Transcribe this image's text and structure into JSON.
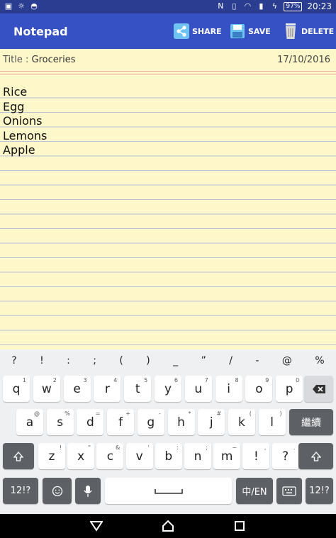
{
  "status_bar": {
    "time": "20:23",
    "battery": "97%"
  },
  "app": {
    "title": "Notepad"
  },
  "actions": {
    "share": "SHARE",
    "save": "SAVE",
    "delete": "DELETE"
  },
  "note": {
    "title_prefix": "Title : ",
    "title": "Groceries",
    "date": "17/10/2016",
    "lines": [
      "Rice",
      "Egg",
      "Onions",
      "Lemons",
      "Apple"
    ]
  },
  "keyboard": {
    "suggestions": [
      "?",
      "!",
      ":",
      ";",
      "(",
      ")",
      "_",
      "”",
      "/",
      "-",
      "@",
      "%"
    ],
    "row1": [
      {
        "k": "q",
        "s": "1"
      },
      {
        "k": "w",
        "s": "2"
      },
      {
        "k": "e",
        "s": "3"
      },
      {
        "k": "r",
        "s": "4"
      },
      {
        "k": "t",
        "s": "5"
      },
      {
        "k": "y",
        "s": "6"
      },
      {
        "k": "u",
        "s": "7"
      },
      {
        "k": "i",
        "s": "8"
      },
      {
        "k": "o",
        "s": "9"
      },
      {
        "k": "p",
        "s": "0"
      }
    ],
    "row2": [
      {
        "k": "a",
        "s": "@"
      },
      {
        "k": "s",
        "s": "%"
      },
      {
        "k": "d",
        "s": "="
      },
      {
        "k": "f",
        "s": "+"
      },
      {
        "k": "g",
        "s": "-"
      },
      {
        "k": "h",
        "s": "*"
      },
      {
        "k": "j",
        "s": "#"
      },
      {
        "k": "k",
        "s": "("
      },
      {
        "k": "l",
        "s": ")"
      }
    ],
    "row3": [
      {
        "k": "z",
        "s": "!"
      },
      {
        "k": "x",
        "s": "“"
      },
      {
        "k": "c",
        "s": "&"
      },
      {
        "k": "v",
        "s": "'"
      },
      {
        "k": "b",
        "s": ":"
      },
      {
        "k": "n",
        "s": ";"
      },
      {
        "k": "m",
        "s": "~"
      },
      {
        "k": "!",
        "s": ","
      },
      {
        "k": "?",
        "s": "."
      }
    ],
    "enter_label": "繼續",
    "sym_label": "12!?",
    "lang_label": "中/EN"
  },
  "colors": {
    "status_bar": "#2b3d91",
    "app_bar": "#3551c4",
    "paper": "#fef7c9",
    "rule": "#b7c2e0",
    "margin_rule": "#e8a59a"
  }
}
